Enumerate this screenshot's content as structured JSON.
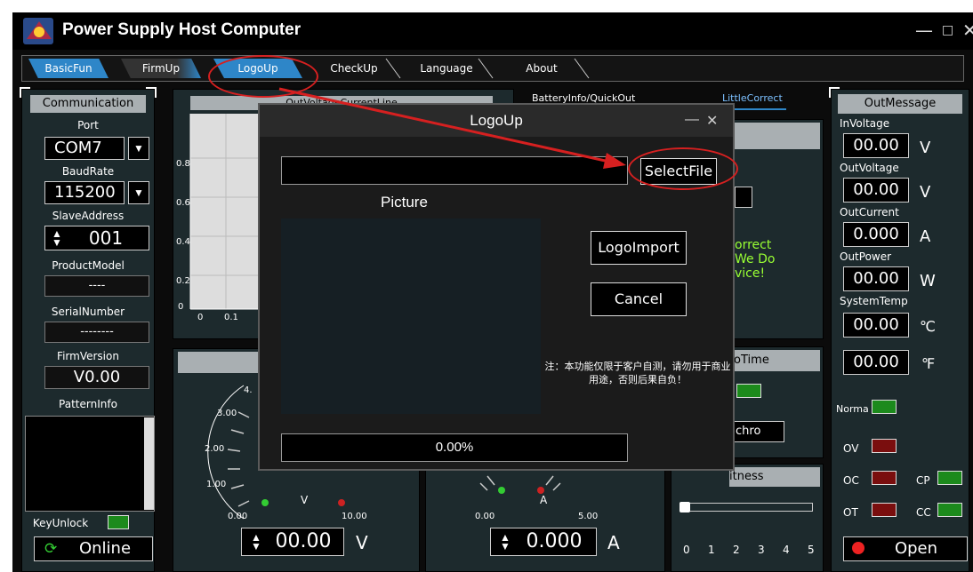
{
  "app": {
    "title": "Power Supply Host Computer",
    "minimize": "—",
    "maximize": "□",
    "close": "✕"
  },
  "tabs": [
    "BasicFun",
    "FirmUp",
    "LogoUp",
    "CheckUp",
    "Language",
    "About"
  ],
  "subtabs": [
    "BatteryInfo/QuickOut",
    "LittleCorrect"
  ],
  "communication": {
    "header": "Communication",
    "port_label": "Port",
    "port_value": "COM7",
    "baud_label": "BaudRate",
    "baud_value": "115200",
    "slave_label": "SlaveAddress",
    "slave_value": "001",
    "model_label": "ProductModel",
    "model_value": "----",
    "serial_label": "SerialNumber",
    "serial_value": "--------",
    "firm_label": "FirmVersion",
    "firm_value": "V0.00",
    "pattern_label": "PatternInfo",
    "keyunlock": "KeyUnlock",
    "online": "Online"
  },
  "chart": {
    "yticks": [
      "0.8",
      "0.6",
      "0.4",
      "0.2",
      "0"
    ],
    "xticks": [
      "0",
      "0.1"
    ],
    "partial_title": "OutVoltageCurrentLine"
  },
  "gauges": {
    "v_ticks": [
      "4.",
      "3.00",
      "2.00",
      "1.00",
      "0.00",
      "10.00"
    ],
    "v_unit": "V",
    "a_ticks": [
      "0.00",
      "5.00"
    ],
    "a_unit": "A"
  },
  "setpoints": {
    "voltage": "00.00",
    "voltage_unit": "V",
    "current": "0.000",
    "current_unit": "A"
  },
  "behind": {
    "correct_text": "orrect\nWe Do\nvice!",
    "zero_time": "roTime",
    "synchro": "chro",
    "brightness": "itness",
    "slider_ticks": [
      "0",
      "1",
      "2",
      "3",
      "4",
      "5"
    ]
  },
  "outmessage": {
    "header": "OutMessage",
    "involtage_label": "InVoltage",
    "involtage": "00.00",
    "involtage_unit": "V",
    "outvoltage_label": "OutVoltage",
    "outvoltage": "00.00",
    "outvoltage_unit": "V",
    "outcurrent_label": "OutCurrent",
    "outcurrent": "0.000",
    "outcurrent_unit": "A",
    "outpower_label": "OutPower",
    "outpower": "00.00",
    "outpower_unit": "W",
    "systemp_label": "SystemTemp",
    "systemp_c": "00.00",
    "unit_c": "℃",
    "systemp_f": "00.00",
    "unit_f": "℉",
    "normal": "Norma",
    "ov": "OV",
    "oc": "OC",
    "cp": "CP",
    "ot": "OT",
    "cc": "CC",
    "open": "Open"
  },
  "dialog": {
    "title": "LogoUp",
    "minimize": "—",
    "close": "✕",
    "file_path": "",
    "select_file": "SelectFile",
    "picture_label": "Picture",
    "logo_import": "LogoImport",
    "cancel": "Cancel",
    "note": "注：本功能仅限于客户自测，请勿用于商业用途，否则后果自负！",
    "progress": "0.00%"
  },
  "colors": {
    "accent": "#2e86c8",
    "panel": "#1d2a2d",
    "led_green": "#1c8a1c",
    "led_red": "#7a0e0e",
    "annotation": "#d62020"
  }
}
